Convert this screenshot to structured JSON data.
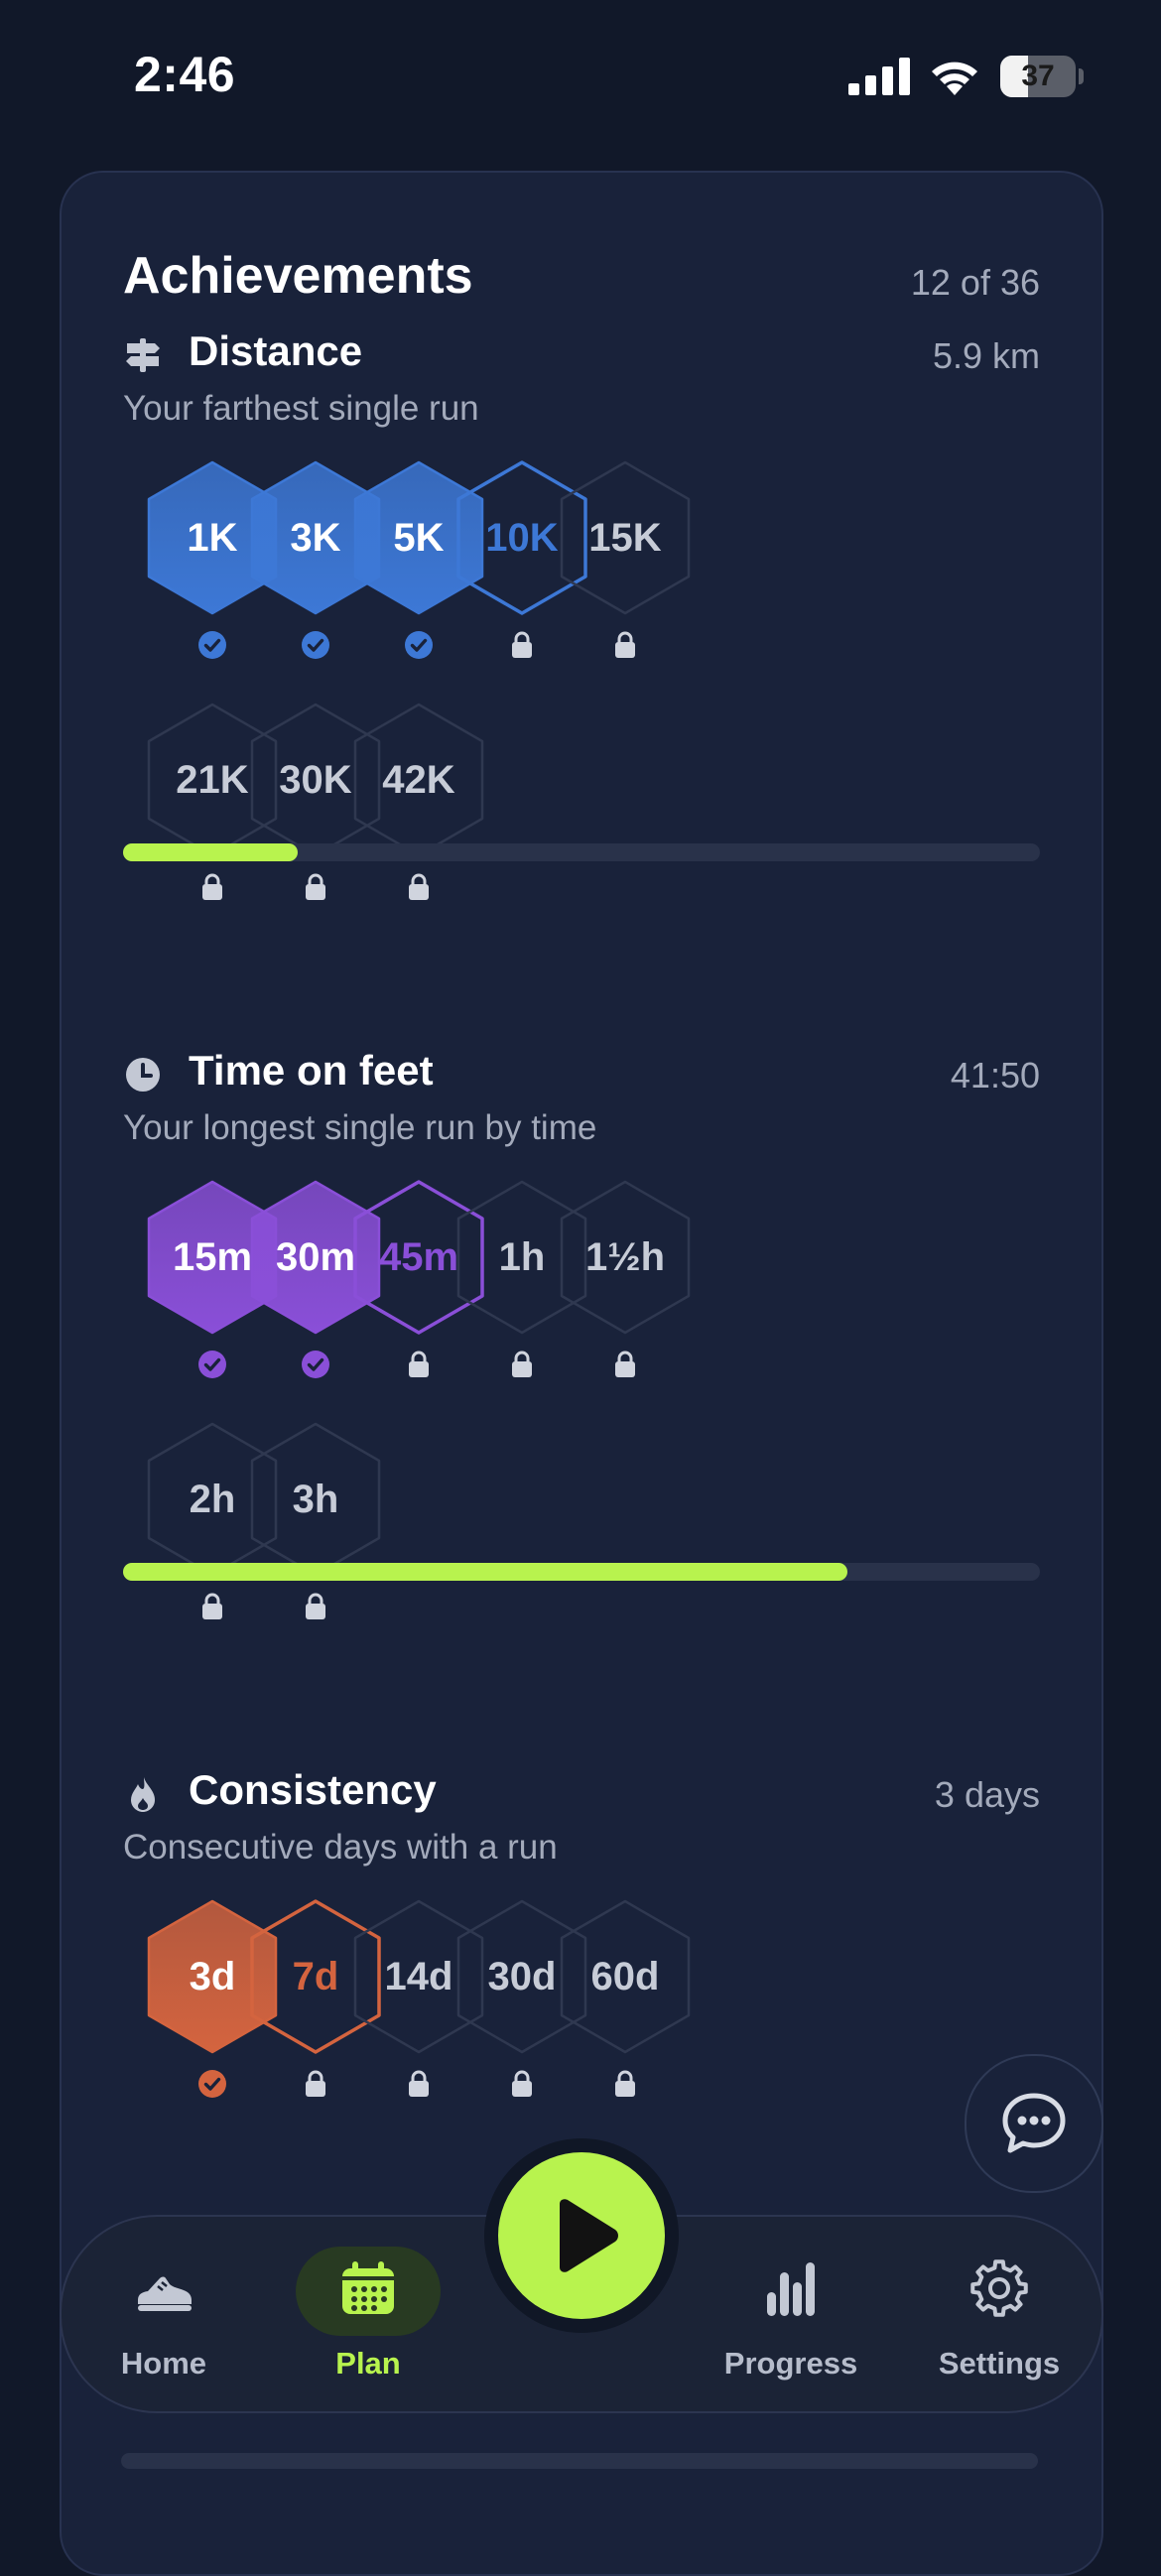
{
  "status": {
    "time": "2:46",
    "battery_level": "37",
    "battery_fraction": 0.37
  },
  "achievements": {
    "title": "Achievements",
    "count": "12 of 36",
    "sections": [
      {
        "title": "Distance",
        "icon": "signpost-icon",
        "value": "5.9 km",
        "subtitle": "Your farthest single run",
        "accent": "#3d78d6",
        "progress": 0.19,
        "badges": [
          {
            "label": "1K",
            "state": "earned"
          },
          {
            "label": "3K",
            "state": "earned"
          },
          {
            "label": "5K",
            "state": "earned"
          },
          {
            "label": "10K",
            "state": "next"
          },
          {
            "label": "15K",
            "state": "locked"
          },
          {
            "label": "21K",
            "state": "locked"
          },
          {
            "label": "30K",
            "state": "locked"
          },
          {
            "label": "42K",
            "state": "locked"
          }
        ]
      },
      {
        "title": "Time on feet",
        "icon": "clock-icon",
        "value": "41:50",
        "subtitle": "Your longest single run by time",
        "accent": "#8a4fd8",
        "progress": 0.79,
        "badges": [
          {
            "label": "15m",
            "state": "earned"
          },
          {
            "label": "30m",
            "state": "earned"
          },
          {
            "label": "45m",
            "state": "next"
          },
          {
            "label": "1h",
            "state": "locked"
          },
          {
            "label": "1½h",
            "state": "locked"
          },
          {
            "label": "2h",
            "state": "locked"
          },
          {
            "label": "3h",
            "state": "locked"
          }
        ]
      },
      {
        "title": "Consistency",
        "icon": "flame-icon",
        "value": "3 days",
        "subtitle": "Consecutive days with a run",
        "accent": "#d4643f",
        "progress": 0.0,
        "badges": [
          {
            "label": "3d",
            "state": "earned"
          },
          {
            "label": "7d",
            "state": "next"
          },
          {
            "label": "14d",
            "state": "locked"
          },
          {
            "label": "30d",
            "state": "locked"
          },
          {
            "label": "60d",
            "state": "locked"
          }
        ]
      }
    ]
  },
  "nav": {
    "items": [
      {
        "label": "Home",
        "icon": "sneaker-icon",
        "active": false
      },
      {
        "label": "Plan",
        "icon": "calendar-icon",
        "active": true
      },
      {
        "label": "Progress",
        "icon": "bar-chart-icon",
        "active": false
      },
      {
        "label": "Settings",
        "icon": "gear-icon",
        "active": false
      }
    ],
    "play_icon": "play-icon"
  },
  "colors": {
    "background": "#111829",
    "card": "#19223a",
    "lime_accent": "#b8f34e",
    "distance": "#3d78d6",
    "time": "#8a4fd8",
    "consistency": "#d4643f",
    "muted_text": "#a3aabb"
  }
}
